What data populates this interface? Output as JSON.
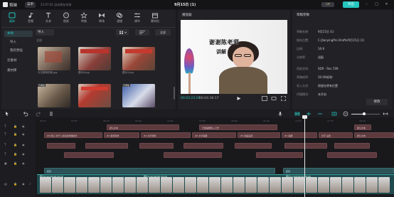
{
  "app": {
    "name": "剪映",
    "menu_label": "菜单",
    "autosave": "23:07:02 自动保存本地",
    "project_title": "9月15日 (1)",
    "vip_label": "VIP",
    "export_label": "导出"
  },
  "colors": {
    "accent": "#25c6c0",
    "clip_text": "#5c3a3e",
    "clip_audio": "#2a5257"
  },
  "media": {
    "tools": [
      {
        "label": "媒体",
        "icon": "media-icon"
      },
      {
        "label": "音频",
        "icon": "audio-icon"
      },
      {
        "label": "文本",
        "icon": "text-icon"
      },
      {
        "label": "贴纸",
        "icon": "sticker-icon"
      },
      {
        "label": "特效",
        "icon": "effects-icon"
      },
      {
        "label": "转场",
        "icon": "transition-icon"
      },
      {
        "label": "滤镜",
        "icon": "filter-icon"
      },
      {
        "label": "调节",
        "icon": "adjust-icon"
      },
      {
        "label": "素材包",
        "icon": "package-icon"
      }
    ],
    "sidebar": [
      {
        "label": "本地"
      },
      {
        "label": "导入"
      },
      {
        "label": "我的预设"
      },
      {
        "label": "云素材"
      },
      {
        "label": "素材库"
      }
    ],
    "import_label": "导入",
    "all_label": "全部",
    "section_label": "全部",
    "thumbs": [
      {
        "caption": "今日推荐的美.jpg"
      },
      {
        "caption": "图片8.jpg"
      },
      {
        "caption": "图片9.jpg"
      },
      {
        "caption": "已添加"
      },
      {
        "caption": ""
      },
      {
        "caption": "已添加"
      }
    ]
  },
  "player": {
    "title": "播放器",
    "overlay_text_1": "谢谢陈老师",
    "overlay_text_2": "讲解",
    "timecode_current": "00:03:23:29",
    "timecode_total": "00:04:38:17"
  },
  "details": {
    "title": "草稿参数",
    "rows": [
      {
        "label": "草稿名称:",
        "value": "9月15日 (1)"
      },
      {
        "label": "保存位置:",
        "value": "C:/JianyingPro Drafts/9月15日 (1)"
      },
      {
        "label": "比例:",
        "value": "16:9"
      },
      {
        "label": "分辨率:",
        "value": "适配"
      },
      {
        "label": "色彩空间:",
        "value": "SDR - Rec.709"
      },
      {
        "label": "草稿帧率:",
        "value": "30.00帧/秒"
      },
      {
        "label": "导入方式:",
        "value": "保留在原有位置"
      }
    ],
    "proxy_label": "代理模式:",
    "proxy_value": "未开启",
    "edit_label": "修改"
  },
  "timeline": {
    "ruler": [
      "00:00",
      "03:00",
      "06:00",
      "09:00",
      "12:00",
      "15:00",
      "18:00",
      "21:00",
      "24:00",
      "27:00",
      "30:00"
    ],
    "text_row_1": [
      "默认文本",
      "已经提醒到入工作",
      "默认文本"
    ],
    "text_row_2": [
      "默认文本",
      "#0 默认 对于人对应的视频模式",
      "#1 发现有效",
      "#1 文字转换",
      "#2 文字提醒",
      "#3 动画设置",
      "#1 提醒",
      "文字 设置"
    ],
    "audio_clips": [
      "配音",
      "配音"
    ],
    "main_labels": [
      "图片8.jpg 00:00:15:10",
      "图片9.jpg 00:00:15:10",
      "图片5.mp4 00:00:00:00"
    ]
  }
}
